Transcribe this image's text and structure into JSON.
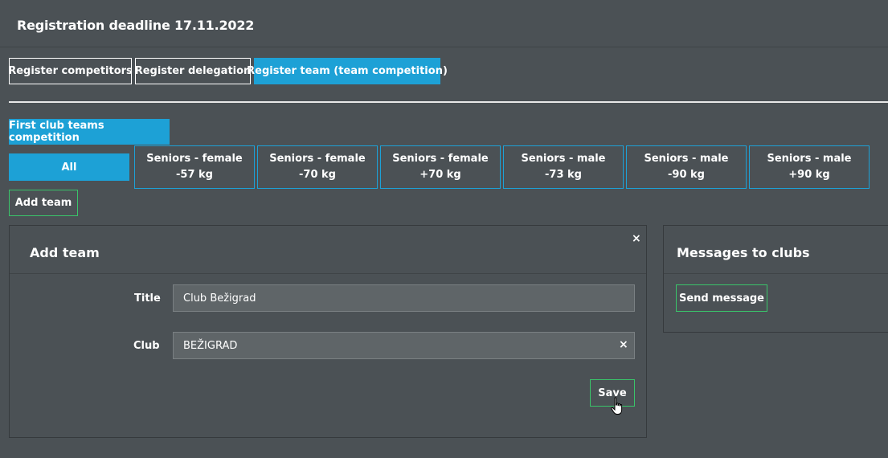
{
  "header": {
    "title": "Registration deadline 17.11.2022"
  },
  "tabs": [
    {
      "label": "Register competitors"
    },
    {
      "label": "Register delegation"
    },
    {
      "label": "Register team (team competition)"
    }
  ],
  "competition_tab": {
    "label": "First club teams competition"
  },
  "categories": {
    "all_label": "All",
    "items": [
      {
        "line1": "Seniors - female",
        "line2": "-57 kg"
      },
      {
        "line1": "Seniors - female",
        "line2": "-70 kg"
      },
      {
        "line1": "Seniors - female",
        "line2": "+70 kg"
      },
      {
        "line1": "Seniors - male",
        "line2": "-73 kg"
      },
      {
        "line1": "Seniors - male",
        "line2": "-90 kg"
      },
      {
        "line1": "Seniors - male",
        "line2": "+90 kg"
      }
    ]
  },
  "add_team_button": {
    "label": "Add team"
  },
  "add_team_panel": {
    "title": "Add team",
    "close_icon": "×",
    "title_label": "Title",
    "title_value": "Club Bežigrad",
    "club_label": "Club",
    "club_value": "BEŽIGRAD",
    "clear_icon": "×",
    "save_label": "Save"
  },
  "messages_panel": {
    "title": "Messages to clubs",
    "send_label": "Send message"
  },
  "colors": {
    "background": "#4b5155",
    "accent": "#1da1d6",
    "success": "#3ac46a"
  },
  "icons": {
    "close": "close-icon",
    "clear": "clear-icon",
    "pointer": "hand-pointer-icon"
  }
}
